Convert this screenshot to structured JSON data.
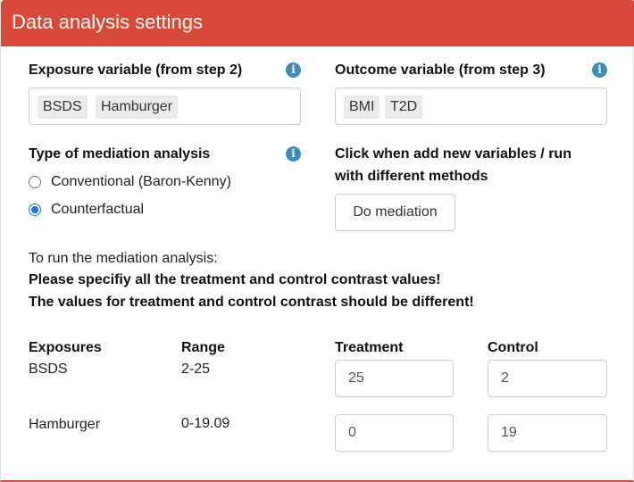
{
  "panel": {
    "title": "Data analysis settings",
    "header_color": "#d9493a"
  },
  "exposure": {
    "label": "Exposure variable (from step 2)",
    "tags": [
      "BSDS",
      "Hamburger"
    ]
  },
  "outcome": {
    "label": "Outcome variable (from step 3)",
    "tags": [
      "BMI",
      "T2D"
    ]
  },
  "mediation": {
    "label": "Type of mediation analysis",
    "options": [
      "Conventional (Baron-Kenny)",
      "Counterfactual"
    ],
    "selected": "Counterfactual"
  },
  "action": {
    "label_line1": "Click when add new variables / run",
    "label_line2": "with different methods",
    "button_label": "Do mediation"
  },
  "instructions": {
    "line1": "To run the mediation analysis:",
    "line2": "Please specifiy all the treatment and control contrast values!",
    "line3": "The values for treatment and control contrast should be different!"
  },
  "contrast_table": {
    "headers": [
      "Exposures",
      "Range",
      "Treatment",
      "Control"
    ],
    "rows": [
      {
        "exposure": "BSDS",
        "range": "2-25",
        "treatment": "25",
        "control": "2"
      },
      {
        "exposure": "Hamburger",
        "range": "0-19.09",
        "treatment": "0",
        "control": "19"
      }
    ]
  },
  "icons": {
    "info": "info-icon",
    "accent": "#3c8dbc",
    "radio_accent": "#1a73e8"
  }
}
